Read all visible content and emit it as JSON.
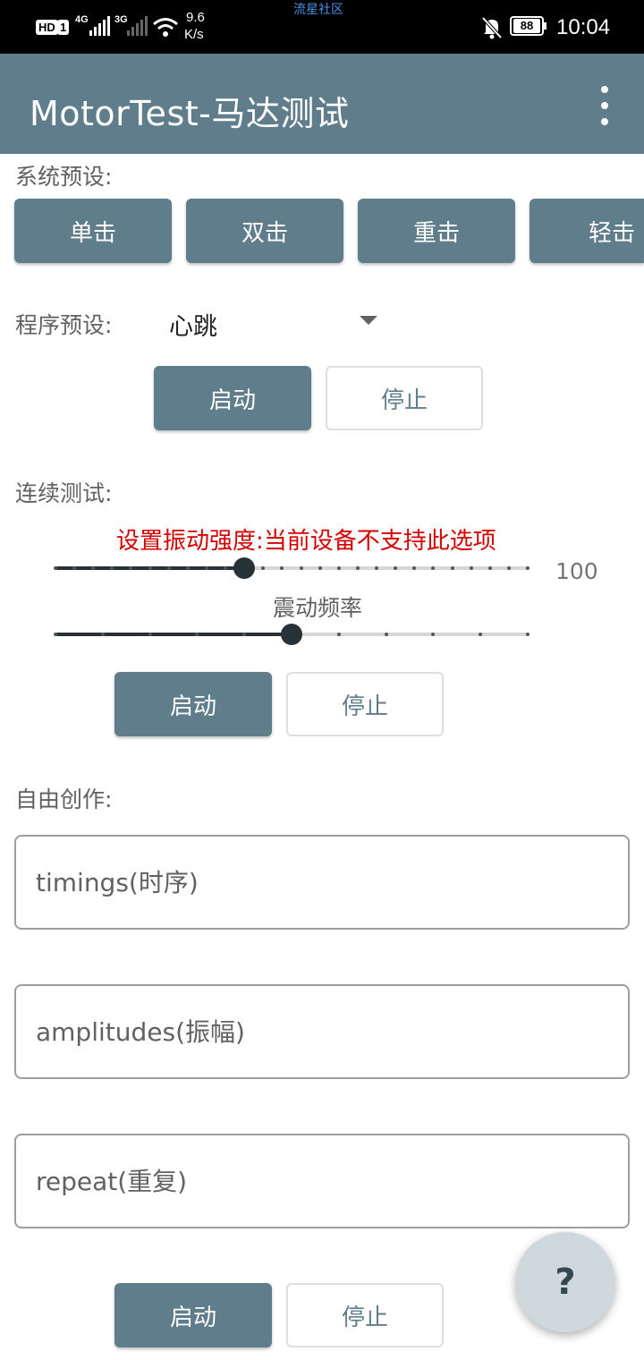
{
  "status_bar": {
    "hd": "HD",
    "sim": "1",
    "net1": "4G",
    "net2": "3G",
    "speed_value": "9.6",
    "speed_unit": "K/s",
    "watermark": "流星社区",
    "battery": "88",
    "time": "10:04"
  },
  "app_bar": {
    "title": "MotorTest-马达测试"
  },
  "system_preset": {
    "label": "系统预设:",
    "buttons": [
      "单击",
      "双击",
      "重击",
      "轻击"
    ]
  },
  "program_preset": {
    "label": "程序预设:",
    "selected": "心跳",
    "start": "启动",
    "stop": "停止"
  },
  "continuous_test": {
    "label": "连续测试:",
    "intensity_warning": "设置振动强度:当前设备不支持此选项",
    "intensity_value": "100",
    "intensity_fraction": 0.4,
    "frequency_label": "震动频率",
    "frequency_fraction": 0.5,
    "start": "启动",
    "stop": "停止"
  },
  "free_creation": {
    "label": "自由创作:",
    "timings_placeholder": "timings(时序)",
    "amplitudes_placeholder": "amplitudes(振幅)",
    "repeat_placeholder": "repeat(重复)",
    "start": "启动",
    "stop": "停止"
  },
  "fab": {
    "label": "?"
  },
  "colors": {
    "primary": "#607d8b",
    "warning": "#d50000",
    "slider_active": "#263238"
  }
}
